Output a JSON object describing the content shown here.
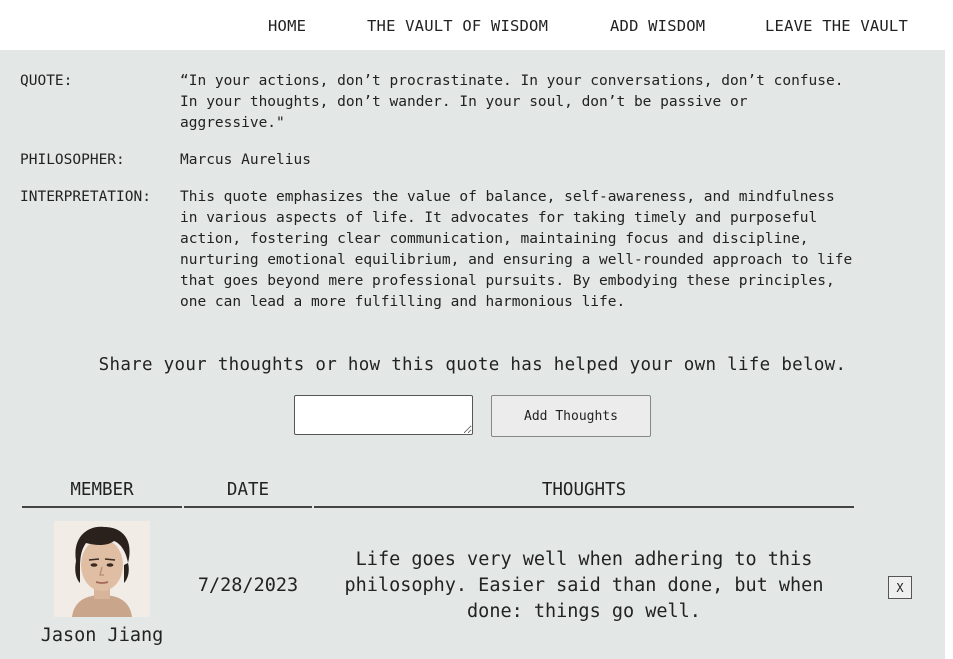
{
  "nav": {
    "home": "HOME",
    "vault": "THE VAULT OF WISDOM",
    "add": "ADD WISDOM",
    "leave": "LEAVE THE VAULT"
  },
  "quote": {
    "label": "QUOTE:",
    "text": "“In your actions, don’t procrastinate. In your conversations, don’t confuse.\nIn your thoughts, don’t wander. In your soul, don’t be passive or\naggressive.\""
  },
  "philosopher": {
    "label": "PHILOSOPHER:",
    "name": "Marcus Aurelius"
  },
  "interpretation": {
    "label": "INTERPRETATION:",
    "text": "This quote emphasizes the value of balance, self-awareness, and mindfulness\nin various aspects of life. It advocates for taking timely and purposeful\naction, fostering clear communication, maintaining focus and discipline,\nnurturing emotional equilibrium, and ensuring a well-rounded approach to life\nthat goes beyond mere professional pursuits. By embodying these principles,\none can lead a more fulfilling and harmonious life."
  },
  "share": {
    "prompt": "Share your thoughts or how this quote has helped your own life below.",
    "input_value": "",
    "button_label": "Add Thoughts"
  },
  "table": {
    "headers": {
      "member": "MEMBER",
      "date": "DATE",
      "thoughts": "THOUGHTS"
    },
    "rows": [
      {
        "member": "Jason Jiang",
        "date": "7/28/2023",
        "thoughts": "Life goes very well when adhering to this\nphilosophy. Easier said than done, but when\ndone: things go well.",
        "delete_label": "X"
      }
    ]
  },
  "colors": {
    "panel_bg": "#e3e7e5",
    "nav_bg": "#ffffff",
    "text": "#222222"
  }
}
